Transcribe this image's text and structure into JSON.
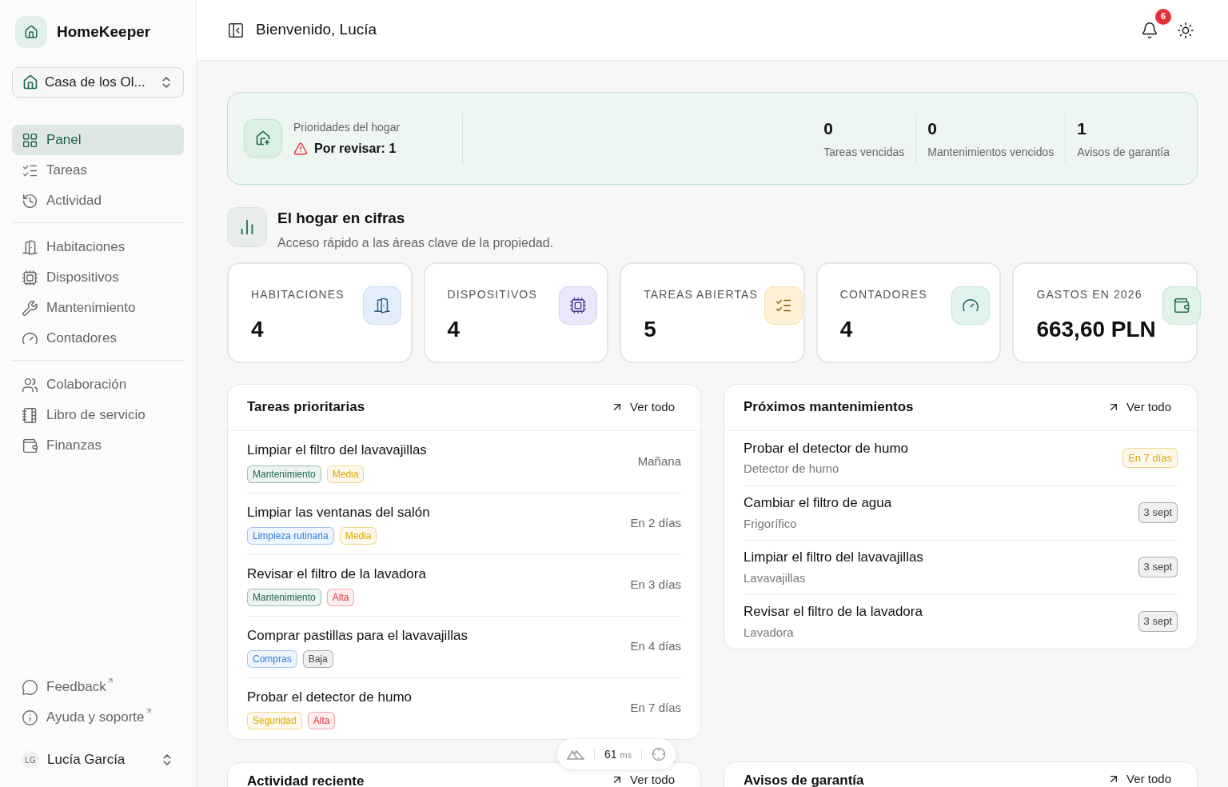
{
  "app": {
    "name": "HomeKeeper"
  },
  "property_selector": {
    "value": "Casa de los Ol..."
  },
  "sidebar": {
    "groups": [
      [
        {
          "label": "Panel",
          "selected": true
        },
        {
          "label": "Tareas",
          "selected": false
        },
        {
          "label": "Actividad",
          "selected": false
        }
      ],
      [
        {
          "label": "Habitaciones",
          "selected": false
        },
        {
          "label": "Dispositivos",
          "selected": false
        },
        {
          "label": "Mantenimiento",
          "selected": false
        },
        {
          "label": "Contadores",
          "selected": false
        }
      ],
      [
        {
          "label": "Colaboración",
          "selected": false
        },
        {
          "label": "Libro de servicio",
          "selected": false
        },
        {
          "label": "Finanzas",
          "selected": false
        }
      ]
    ],
    "footer_links": [
      {
        "label": "Feedback"
      },
      {
        "label": "Ayuda y soporte"
      }
    ],
    "user": {
      "initials": "LG",
      "name": "Lucía García"
    }
  },
  "header": {
    "title": "Bienvenido, Lucía",
    "notifications": "6"
  },
  "priorities": {
    "title": "Prioridades del hogar",
    "alert": "Por revisar: 1",
    "stats": [
      {
        "value": "0",
        "label": "Tareas vencidas"
      },
      {
        "value": "0",
        "label": "Mantenimientos vencidos"
      },
      {
        "value": "1",
        "label": "Avisos de garantía"
      }
    ]
  },
  "figures": {
    "title": "El hogar en cifras",
    "subtitle": "Acceso rápido a las áreas clave de la propiedad.",
    "cards": [
      {
        "label": "HABITACIONES",
        "value": "4"
      },
      {
        "label": "DISPOSITIVOS",
        "value": "4"
      },
      {
        "label": "TAREAS ABIERTAS",
        "value": "5"
      },
      {
        "label": "CONTADORES",
        "value": "4"
      },
      {
        "label": "GASTOS EN 2026",
        "value": "663,60 PLN"
      }
    ]
  },
  "priority_tasks": {
    "title": "Tareas prioritarias",
    "link": "Ver todo",
    "rows": [
      {
        "title": "Limpiar el filtro del lavavajillas",
        "due": "Mañana",
        "tags": [
          {
            "label": "Mantenimiento",
            "color": "#1f6b4f"
          },
          {
            "label": "Media",
            "color": "#e0a800"
          }
        ]
      },
      {
        "title": "Limpiar las ventanas del salón",
        "due": "En 2 días",
        "tags": [
          {
            "label": "Limpieza rutinaria",
            "color": "#2f7de1"
          },
          {
            "label": "Media",
            "color": "#e0a800"
          }
        ]
      },
      {
        "title": "Revisar el filtro de la lavadora",
        "due": "En 3 días",
        "tags": [
          {
            "label": "Mantenimiento",
            "color": "#1f6b4f"
          },
          {
            "label": "Alta",
            "color": "#e5303a"
          }
        ]
      },
      {
        "title": "Comprar pastillas para el lavavajillas",
        "due": "En 4 días",
        "tags": [
          {
            "label": "Compras",
            "color": "#2f7de1"
          },
          {
            "label": "Baja",
            "color": "#444444"
          }
        ]
      },
      {
        "title": "Probar el detector de humo",
        "due": "En 7 días",
        "tags": [
          {
            "label": "Seguridad",
            "color": "#e0a800"
          },
          {
            "label": "Alta",
            "color": "#e5303a"
          }
        ]
      }
    ]
  },
  "upcoming_maintenance": {
    "title": "Próximos mantenimientos",
    "link": "Ver todo",
    "rows": [
      {
        "title": "Probar el detector de humo",
        "subtitle": "Detector de humo",
        "badge": "En 7 días",
        "color": "#e0a800"
      },
      {
        "title": "Cambiar el filtro de agua",
        "subtitle": "Frigorífico",
        "badge": "3 sept",
        "color": "#444444"
      },
      {
        "title": "Limpiar el filtro del lavavajillas",
        "subtitle": "Lavavajillas",
        "badge": "3 sept",
        "color": "#444444"
      },
      {
        "title": "Revisar el filtro de la lavadora",
        "subtitle": "Lavadora",
        "badge": "3 sept",
        "color": "#444444"
      }
    ]
  },
  "recent_activity": {
    "title": "Actividad reciente",
    "link": "Ver todo"
  },
  "warranty_notices": {
    "title": "Avisos de garantía",
    "link": "Ver todo"
  },
  "dev_toolbar": {
    "timing": "61",
    "unit": "ms"
  }
}
